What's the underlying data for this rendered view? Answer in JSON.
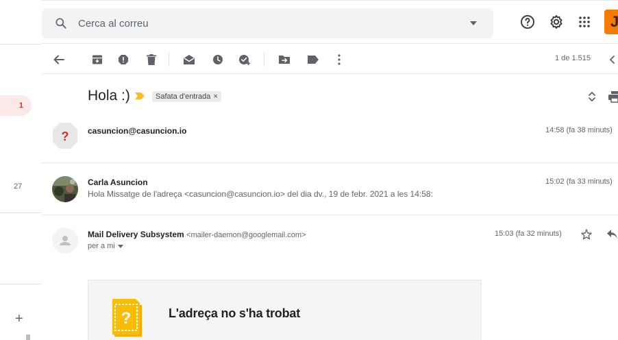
{
  "search": {
    "placeholder": "Cerca al correu"
  },
  "sidebar": {
    "unread_badge": "1",
    "count": "27"
  },
  "account": {
    "avatar_letter": "J",
    "avatar_color": "#f57c00"
  },
  "toolbar": {
    "pager": "1 de 1.515"
  },
  "thread": {
    "subject": "Hola :)",
    "label_chip": "Safata d'entrada",
    "label_remove": "×"
  },
  "messages": [
    {
      "sender": "casuncion@casuncion.io",
      "time": "14:58 (fa 38 minuts)",
      "avatar": "?"
    },
    {
      "sender": "Carla Asuncion",
      "time": "15:02 (fa 33 minuts)",
      "snippet": "Hola Missatge de l'adreça <casuncion@casuncion.io> del dia dv., 19 de febr. 2021 a les 14:58:"
    },
    {
      "sender": "Mail Delivery Subsystem",
      "sender_email": "<mailer-daemon@googlemail.com>",
      "time": "15:03 (fa 32 minuts)",
      "to": "per a mi"
    }
  ],
  "bounce": {
    "title": "L'adreça no s'ha trobat",
    "icon_glyph": "?"
  },
  "colors": {
    "accent_red": "#d93025",
    "label_yellow": "#f6bf26",
    "bounce_orange": "#f9ab00"
  }
}
